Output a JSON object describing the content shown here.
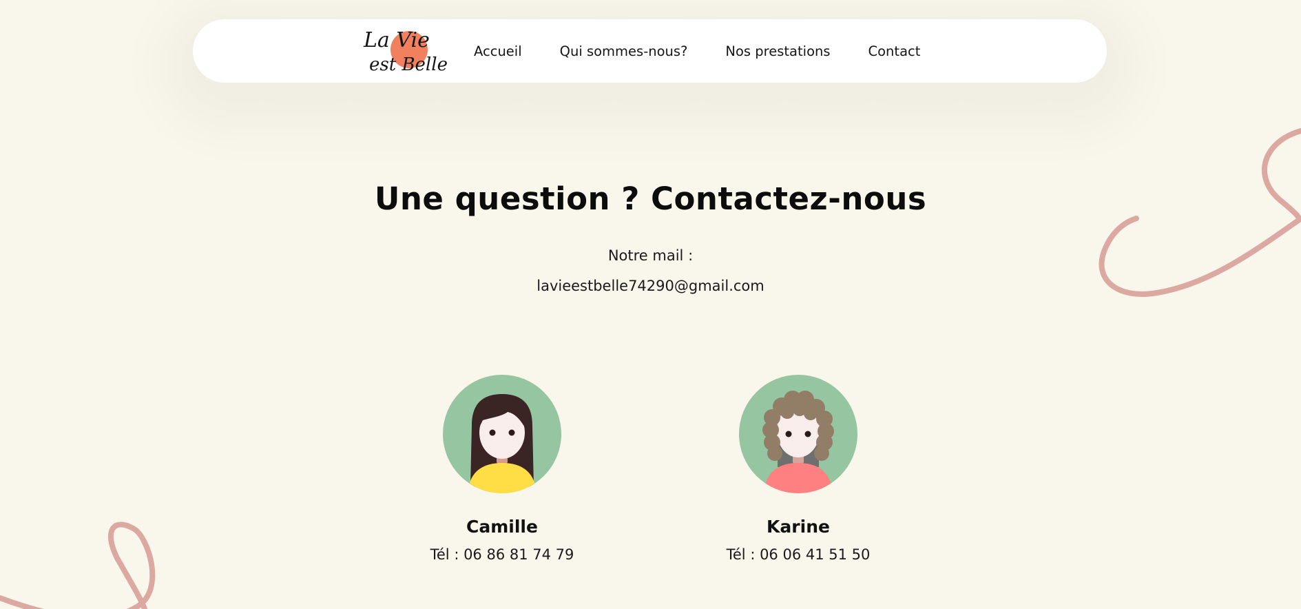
{
  "brand": {
    "logo_text_line1": "La Vie",
    "logo_text_line2": "est Belle",
    "accent_color": "#f0805e"
  },
  "nav": {
    "items": [
      {
        "label": "Accueil"
      },
      {
        "label": "Qui sommes-nous?"
      },
      {
        "label": "Nos prestations"
      },
      {
        "label": "Contact"
      }
    ]
  },
  "contact": {
    "heading": "Une question ? Contactez-nous",
    "mail_label": "Notre mail :",
    "mail_address": "lavieestbelle74290@gmail.com"
  },
  "people": [
    {
      "name": "Camille",
      "phone": "Tél : 06 86 81 74 79",
      "avatar_icon": "woman-dark-hair-avatar-icon"
    },
    {
      "name": "Karine",
      "phone": "Tél : 06 06 41 51 50",
      "avatar_icon": "woman-curly-hair-avatar-icon"
    }
  ],
  "colors": {
    "background": "#f9f6eb",
    "decoration": "#dba9a2",
    "avatar_bg": "#95c5a1"
  }
}
